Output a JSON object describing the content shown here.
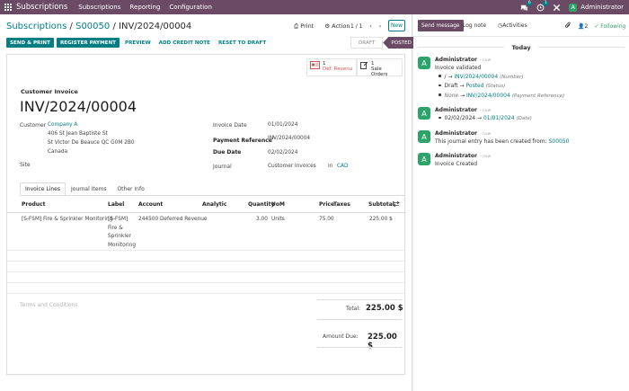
{
  "navbar": {
    "app": "Subscriptions",
    "menu": [
      "Subscriptions",
      "Reporting",
      "Configuration"
    ],
    "chat_badge": "6",
    "activity_badge": "1",
    "user_initial": "A",
    "user": "Administrator"
  },
  "breadcrumb": {
    "parent": "Subscriptions",
    "sub": "S00050",
    "current": "INV/2024/00004",
    "sep": "/"
  },
  "actions": {
    "print": "Print",
    "action": "Action",
    "pager": "1 / 1",
    "prev": "‹",
    "next": "›",
    "new": "New"
  },
  "toolbar": {
    "send_print": "SEND & PRINT",
    "register_payment": "REGISTER PAYMENT",
    "preview": "PREVIEW",
    "add_credit_note": "ADD CREDIT NOTE",
    "reset_to_draft": "RESET TO DRAFT"
  },
  "status": {
    "draft": "DRAFT",
    "posted": "POSTED"
  },
  "smart_buttons": [
    {
      "count": "1",
      "label": "Def. Revenu"
    },
    {
      "count": "1",
      "label": "Sale Orders"
    }
  ],
  "invoice": {
    "type": "Customer Invoice",
    "number": "INV/2024/00004",
    "customer_label": "Customer",
    "customer": "Company A",
    "address": [
      "406 St Jean Baptiste St",
      "St Victor De Beauce QC G0M 2B0",
      "Canada"
    ],
    "site_label": "Site",
    "date_label": "Invoice Date",
    "date": "01/01/2024",
    "payref_label": "Payment Reference",
    "payref_q": "?",
    "payref": "INV/2024/00004",
    "due_label": "Due Date",
    "due": "02/02/2024",
    "journal_label": "Journal",
    "journal": "Customer Invoices",
    "in": "in",
    "currency": "CAD"
  },
  "tabs": [
    "Invoice Lines",
    "Journal Items",
    "Other Info"
  ],
  "lines": {
    "headers": {
      "product": "Product",
      "label": "Label",
      "account": "Account",
      "analytic": "Analytic",
      "quantity": "Quantity",
      "uom": "UoM",
      "price": "Price",
      "taxes": "Taxes",
      "subtotal": "Subtotal"
    },
    "rows": [
      {
        "product": "[S-FSM] Fire & Sprinkler Monitoring",
        "label": [
          "[S-FSM]",
          "Fire &",
          "Sprinkler",
          "Monitoring"
        ],
        "account": "244500 Deferred Revenue",
        "quantity": "3.00",
        "uom": "Units",
        "price": "75.00",
        "subtotal": "225.00 $"
      }
    ]
  },
  "terms_placeholder": "Terms and Conditions",
  "totals": {
    "total_label": "Total:",
    "total": "225.00 $",
    "amount_due_label": "Amount Due:",
    "amount_due": "225.00 $"
  },
  "chatter": {
    "send": "Send message",
    "log": "Log note",
    "activities": "Activities",
    "attach_count": "2",
    "following": "Following",
    "today": "Today",
    "messages": [
      {
        "author": "Administrator",
        "ago": "- now",
        "title": "Invoice validated",
        "lines": [
          {
            "old": "/",
            "new": "INV/2024/00004",
            "field": "(Number)"
          },
          {
            "old": "Draft",
            "new": "Posted",
            "field": "(Status)"
          },
          {
            "old": "None",
            "new": "INV/2024/00004",
            "field": "(Payment Reference)"
          }
        ]
      },
      {
        "author": "Administrator",
        "ago": "- now",
        "lines": [
          {
            "old": "02/02/2024",
            "new": "01/01/2024",
            "field": "(Date)"
          }
        ]
      },
      {
        "author": "Administrator",
        "ago": "- now",
        "text": "This journal entry has been created from:",
        "link": "S00050"
      },
      {
        "author": "Administrator",
        "ago": "- now",
        "text": "Invoice Created"
      }
    ]
  },
  "colors": {
    "brand": "#6b4a66",
    "accent": "#017e84",
    "avatar": "#2ea36a",
    "danger": "#d9534f"
  }
}
